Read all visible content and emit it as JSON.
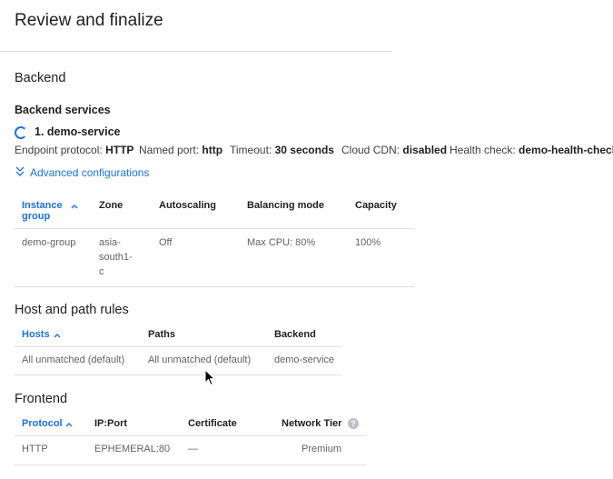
{
  "page": {
    "title": "Review and finalize"
  },
  "backend": {
    "section_title": "Backend",
    "services_title": "Backend services",
    "service_name": "1. demo-service",
    "details": {
      "endpoint_protocol_label": "Endpoint protocol:",
      "endpoint_protocol_value": "HTTP",
      "named_port_label": "Named port:",
      "named_port_value": "http",
      "timeout_label": "Timeout:",
      "timeout_value": "30 seconds",
      "cdn_label": "Cloud CDN:",
      "cdn_value": "disabled",
      "health_check_label": "Health check:",
      "health_check_value": "demo-health-check"
    },
    "advanced_link": "Advanced configurations",
    "table": {
      "col_instance_group_1": "Instance",
      "col_instance_group_2": "group",
      "col_zone": "Zone",
      "col_autoscaling": "Autoscaling",
      "col_balancing_mode": "Balancing mode",
      "col_capacity": "Capacity",
      "row": {
        "instance_group": "demo-group",
        "zone_1": "asia-",
        "zone_2": "south1-",
        "zone_3": "c",
        "autoscaling": "Off",
        "balancing_mode": "Max CPU: 80%",
        "capacity": "100%"
      }
    }
  },
  "host_rules": {
    "section_title": "Host and path rules",
    "col_hosts": "Hosts",
    "col_paths": "Paths",
    "col_backend": "Backend",
    "row": {
      "hosts": "All unmatched (default)",
      "paths": "All unmatched (default)",
      "backend": "demo-service"
    }
  },
  "frontend": {
    "section_title": "Frontend",
    "col_protocol": "Protocol",
    "col_ip_port": "IP:Port",
    "col_certificate": "Certificate",
    "col_network_tier": "Network Tier",
    "row": {
      "protocol": "HTTP",
      "ip_port": "EPHEMERAL:80",
      "certificate": "—",
      "network_tier": "Premium"
    }
  },
  "icons": {
    "spinner": "loading-spinner-icon",
    "advanced": "double-chevron-down-icon",
    "sort": "arrow-up-icon",
    "help": "help-circle-icon",
    "cursor": "mouse-pointer-icon"
  },
  "colors": {
    "accent": "#1a73e8",
    "divider": "#e0e0e0"
  }
}
